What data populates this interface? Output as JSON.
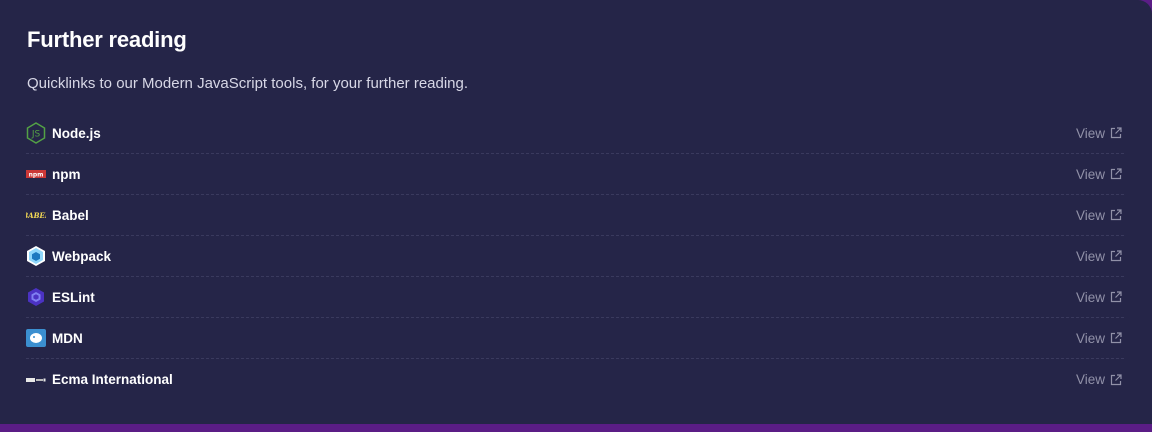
{
  "section": {
    "title": "Further reading",
    "subtitle": "Quicklinks to our Modern JavaScript tools, for your further reading."
  },
  "links": [
    {
      "name": "Node.js",
      "icon": "nodejs-logo-icon",
      "action": "View"
    },
    {
      "name": "npm",
      "icon": "npm-logo-icon",
      "action": "View"
    },
    {
      "name": "Babel",
      "icon": "babel-logo-icon",
      "action": "View"
    },
    {
      "name": "Webpack",
      "icon": "webpack-logo-icon",
      "action": "View"
    },
    {
      "name": "ESLint",
      "icon": "eslint-logo-icon",
      "action": "View"
    },
    {
      "name": "MDN",
      "icon": "mdn-logo-icon",
      "action": "View"
    },
    {
      "name": "Ecma International",
      "icon": "ecma-logo-icon",
      "action": "View"
    }
  ],
  "colors": {
    "card_background": "#252548",
    "page_accent": "#5b1d86",
    "link_text": "#9191a8"
  }
}
